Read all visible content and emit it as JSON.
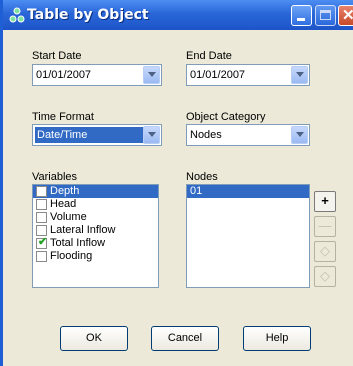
{
  "window": {
    "title": "Table by Object",
    "icon": "app-swmm-icon"
  },
  "fields": {
    "start_date": {
      "label": "Start Date",
      "value": "01/01/2007"
    },
    "end_date": {
      "label": "End Date",
      "value": "01/01/2007"
    },
    "time_format": {
      "label": "Time Format",
      "value": "Date/Time"
    },
    "object_category": {
      "label": "Object Category",
      "value": "Nodes"
    }
  },
  "variables": {
    "label": "Variables",
    "items": [
      {
        "label": "Depth",
        "checked": false,
        "selected": true
      },
      {
        "label": "Head",
        "checked": false,
        "selected": false
      },
      {
        "label": "Volume",
        "checked": false,
        "selected": false
      },
      {
        "label": "Lateral Inflow",
        "checked": false,
        "selected": false
      },
      {
        "label": "Total Inflow",
        "checked": true,
        "selected": false
      },
      {
        "label": "Flooding",
        "checked": false,
        "selected": false
      }
    ]
  },
  "nodes": {
    "label": "Nodes",
    "items": [
      "01"
    ]
  },
  "side_buttons": [
    {
      "icon": "add-icon",
      "glyph": "+"
    },
    {
      "icon": "remove-icon",
      "glyph": "—"
    },
    {
      "icon": "move-up-icon",
      "glyph": "◇"
    },
    {
      "icon": "move-down-icon",
      "glyph": "◇"
    }
  ],
  "buttons": {
    "ok": "OK",
    "cancel": "Cancel",
    "help": "Help"
  }
}
